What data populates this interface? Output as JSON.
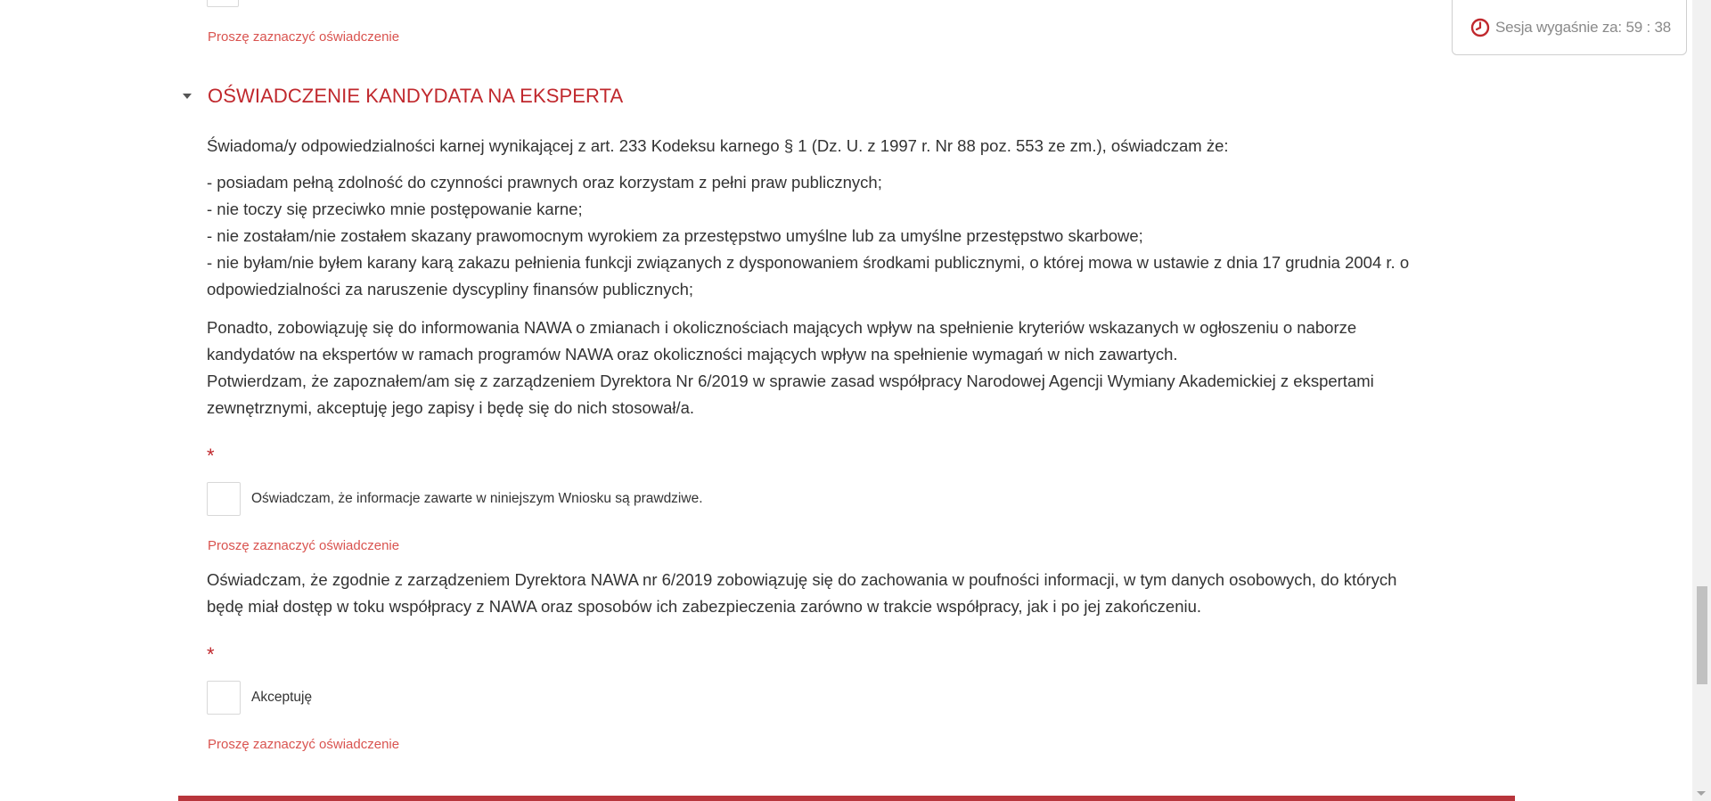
{
  "session": {
    "label": "Sesja wygaśnie za: 59 : 38",
    "icon": "clock-icon",
    "icon_color": "#c0282d"
  },
  "error_text": "Proszę zaznaczyć oświadczenie",
  "section": {
    "title": "OŚWIADCZENIE KANDYDATA NA EKSPERTA",
    "intro": "Świadoma/y odpowiedzialności karnej wynikającej z art. 233 Kodeksu karnego § 1 (Dz. U. z 1997 r. Nr 88 poz. 553 ze zm.), oświadczam że:",
    "list": [
      "- posiadam pełną zdolność do czynności prawnych oraz korzystam z pełni praw publicznych;",
      "- nie toczy się przeciwko mnie postępowanie karne;",
      "- nie zostałam/nie zostałem skazany prawomocnym wyrokiem za przestępstwo umyślne lub za umyślne przestępstwo skarbowe;",
      "- nie byłam/nie byłem karany karą zakazu pełnienia funkcji związanych z dysponowaniem środkami publicznymi, o której mowa w ustawie z dnia 17 grudnia 2004 r. o",
      "odpowiedzialności za naruszenie dyscypliny finansów publicznych;"
    ],
    "commitment": [
      "Ponadto, zobowiązuję się do informowania NAWA o zmianach i okolicznościach mających wpływ na spełnienie kryteriów wskazanych w ogłoszeniu o naborze",
      "kandydatów na ekspertów w ramach programów NAWA oraz okoliczności mających wpływ na spełnienie wymagań w nich zawartych.",
      "Potwierdzam, że zapoznałem/am się z zarządzeniem Dyrektora Nr 6/2019 w sprawie zasad współpracy Narodowej Agencji Wymiany Akademickiej z ekspertami",
      "zewnętrznymi, akceptuję jego zapisy i będę się do nich stosował/a."
    ],
    "required_mark": "*",
    "checkbox1_label": "Oświadczam, że informacje zawarte w niniejszym Wniosku są prawdziwe.",
    "confidentiality": [
      "Oświadczam, że zgodnie z zarządzeniem Dyrektora NAWA nr 6/2019 zobowiązuję się do zachowania w poufności informacji, w tym danych osobowych, do których",
      "będę miał dostęp w toku współpracy z NAWA oraz sposobów ich zabezpieczenia zarówno w trakcie współpracy, jak i po jej zakończeniu."
    ],
    "checkbox2_label": "Akceptuję"
  },
  "colors": {
    "accent": "#c0282d",
    "error": "#d9534f",
    "bottom_bar": "#b8353c"
  }
}
